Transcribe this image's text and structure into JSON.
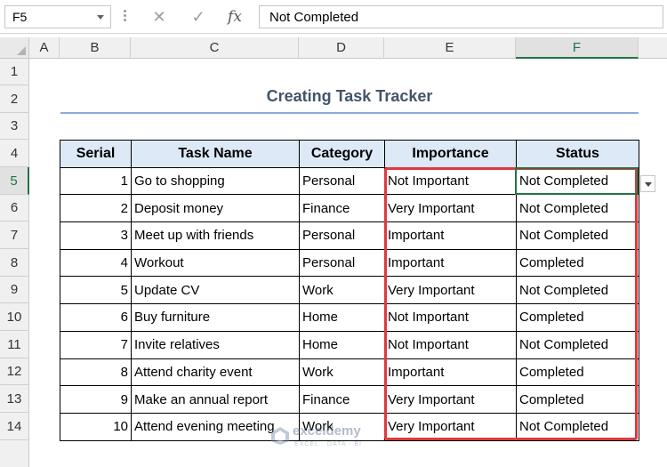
{
  "name_box": "F5",
  "formula_bar": {
    "cancel_icon": "cancel-icon",
    "enter_icon": "check-icon",
    "fx_label": "fx",
    "content": "Not Completed"
  },
  "columns": [
    "A",
    "B",
    "C",
    "D",
    "E",
    "F"
  ],
  "selected_column": "F",
  "rows": [
    "1",
    "2",
    "3",
    "4",
    "5",
    "6",
    "7",
    "8",
    "9",
    "10",
    "11",
    "12",
    "13",
    "14"
  ],
  "selected_row": "5",
  "title": "Creating Task Tracker",
  "table": {
    "headers": [
      "Serial",
      "Task Name",
      "Category",
      "Importance",
      "Status"
    ],
    "rows": [
      {
        "serial": "1",
        "task": "Go to shopping",
        "category": "Personal",
        "importance": "Not Important",
        "status": "Not Completed"
      },
      {
        "serial": "2",
        "task": "Deposit money",
        "category": "Finance",
        "importance": "Very Important",
        "status": "Not Completed"
      },
      {
        "serial": "3",
        "task": "Meet up with friends",
        "category": "Personal",
        "importance": "Important",
        "status": "Not Completed"
      },
      {
        "serial": "4",
        "task": "Workout",
        "category": "Personal",
        "importance": "Important",
        "status": "Completed"
      },
      {
        "serial": "5",
        "task": "Update CV",
        "category": "Work",
        "importance": "Very Important",
        "status": "Not Completed"
      },
      {
        "serial": "6",
        "task": "Buy furniture",
        "category": "Home",
        "importance": "Not Important",
        "status": "Completed"
      },
      {
        "serial": "7",
        "task": "Invite relatives",
        "category": "Home",
        "importance": "Not Important",
        "status": "Not Completed"
      },
      {
        "serial": "8",
        "task": "Attend charity event",
        "category": "Work",
        "importance": "Important",
        "status": "Completed"
      },
      {
        "serial": "9",
        "task": "Make an annual report",
        "category": "Finance",
        "importance": "Very Important",
        "status": "Completed"
      },
      {
        "serial": "10",
        "task": "Attend evening meeting",
        "category": "Work",
        "importance": "Very Important",
        "status": "Not Completed"
      }
    ]
  },
  "watermark": {
    "name": "exceldemy",
    "tagline": "EXCEL · DATA · BI"
  },
  "colors": {
    "header_fill": "#dde9f7",
    "highlight_border": "#e0383e",
    "selection": "#217346",
    "title": "#44546a"
  }
}
